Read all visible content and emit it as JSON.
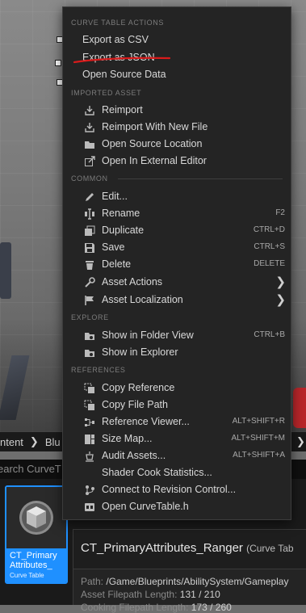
{
  "menu": {
    "sections": [
      {
        "header": "CURVE TABLE ACTIONS",
        "items": [
          {
            "label": "Export as CSV",
            "shortcut": "",
            "icon": "none"
          },
          {
            "label": "Export as JSON",
            "shortcut": "",
            "icon": "none"
          },
          {
            "label": "Open Source Data",
            "shortcut": "",
            "icon": "none"
          }
        ]
      },
      {
        "header": "IMPORTED ASSET",
        "items": [
          {
            "label": "Reimport",
            "shortcut": "",
            "icon": "reimport-icon"
          },
          {
            "label": "Reimport With New File",
            "shortcut": "",
            "icon": "reimport-new-file-icon"
          },
          {
            "label": "Open Source Location",
            "shortcut": "",
            "icon": "folder-icon"
          },
          {
            "label": "Open In External Editor",
            "shortcut": "",
            "icon": "external-editor-icon"
          }
        ]
      },
      {
        "header": "COMMON",
        "items": [
          {
            "label": "Edit...",
            "shortcut": "",
            "icon": "pencil-icon"
          },
          {
            "label": "Rename",
            "shortcut": "F2",
            "icon": "rename-icon"
          },
          {
            "label": "Duplicate",
            "shortcut": "CTRL+D",
            "icon": "duplicate-icon"
          },
          {
            "label": "Save",
            "shortcut": "CTRL+S",
            "icon": "save-icon"
          },
          {
            "label": "Delete",
            "shortcut": "DELETE",
            "icon": "trash-icon"
          },
          {
            "label": "Asset Actions",
            "shortcut": "",
            "icon": "wrench-icon",
            "submenu": true
          },
          {
            "label": "Asset Localization",
            "shortcut": "",
            "icon": "flag-icon",
            "submenu": true
          }
        ]
      },
      {
        "header": "EXPLORE",
        "items": [
          {
            "label": "Show in Folder View",
            "shortcut": "CTRL+B",
            "icon": "folder-view-icon"
          },
          {
            "label": "Show in Explorer",
            "shortcut": "",
            "icon": "explorer-icon"
          }
        ]
      },
      {
        "header": "REFERENCES",
        "items": [
          {
            "label": "Copy Reference",
            "shortcut": "",
            "icon": "copy-reference-icon"
          },
          {
            "label": "Copy File Path",
            "shortcut": "",
            "icon": "copy-path-icon"
          },
          {
            "label": "Reference Viewer...",
            "shortcut": "ALT+SHIFT+R",
            "icon": "reference-viewer-icon"
          },
          {
            "label": "Size Map...",
            "shortcut": "ALT+SHIFT+M",
            "icon": "size-map-icon"
          },
          {
            "label": "Audit Assets...",
            "shortcut": "ALT+SHIFT+A",
            "icon": "audit-icon"
          },
          {
            "label": "Shader Cook Statistics...",
            "shortcut": "",
            "icon": "shader-stats-icon"
          },
          {
            "label": "Connect to Revision Control...",
            "shortcut": "",
            "icon": "revision-control-icon"
          },
          {
            "label": "Open CurveTable.h",
            "shortcut": "",
            "icon": "cpp-header-icon"
          }
        ]
      }
    ]
  },
  "content_browser": {
    "path_items": [
      "ntent",
      "Blu"
    ],
    "search_placeholder": "earch CurveT",
    "asset": {
      "name": "CT_Primary\nAttributes_",
      "type": "Curve Table"
    },
    "tooltip": {
      "title": "CT_PrimaryAttributes_Ranger",
      "title_suffix": "(Curve Tab",
      "path_label": "Path:",
      "path_value": "/Game/Blueprints/AbilitySystem/Gameplay",
      "filepath_length_label": "Asset Filepath Length:",
      "filepath_length_value": "131 / 210",
      "cooking_label": "Cooking Filepath Length:",
      "cooking_value": "173 / 260"
    }
  },
  "colors": {
    "menu_bg": "#242424",
    "selection_blue": "#1f90ff",
    "annotation_red": "#d81b1b"
  }
}
